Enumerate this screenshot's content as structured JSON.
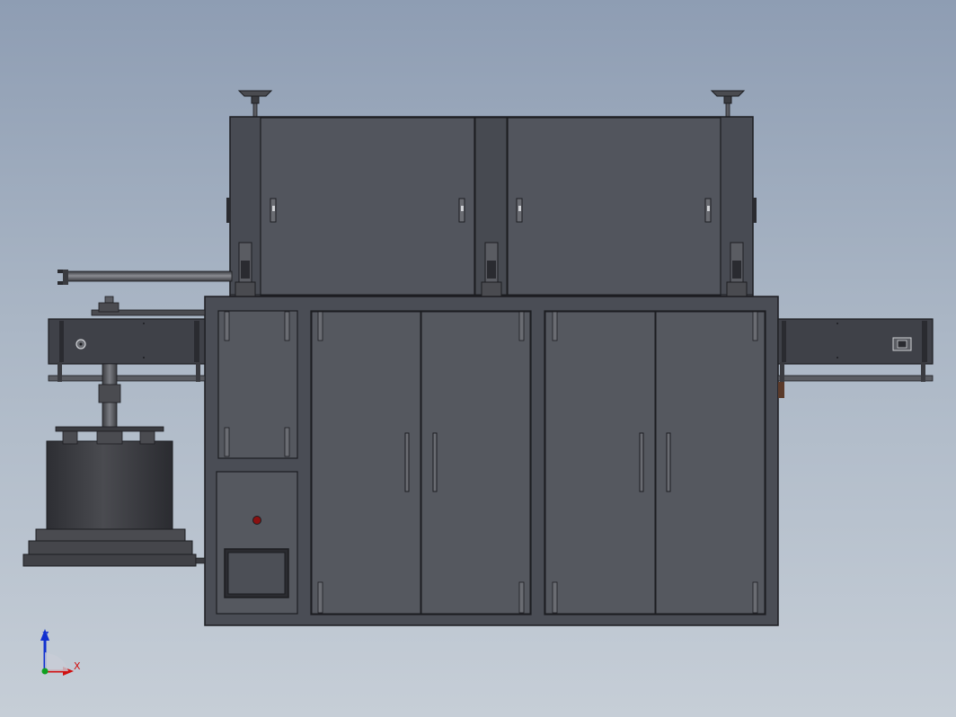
{
  "viewport": {
    "background_top": "#8e9db3",
    "background_bottom": "#c6ced7"
  },
  "palette": {
    "body": "#4a4d55",
    "panel": "#52555d",
    "panel_dark": "#3b3d44",
    "outline": "#1c1d21",
    "accent_red": "#8a1010",
    "axis_x": "#d01010",
    "axis_z": "#1030d0",
    "axis_origin": "#10a020"
  },
  "triad": {
    "z_label": "Z",
    "x_label": "X"
  }
}
